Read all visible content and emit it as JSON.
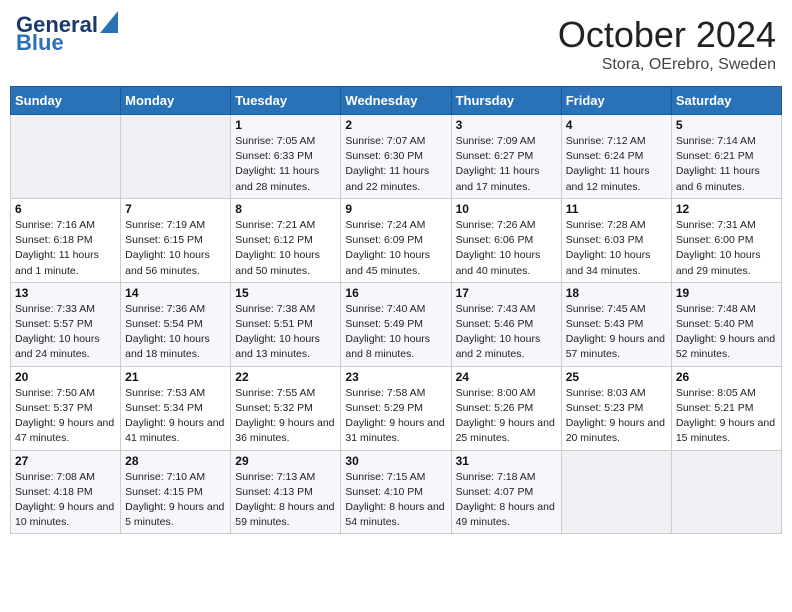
{
  "header": {
    "logo_line1": "General",
    "logo_line2": "Blue",
    "month": "October 2024",
    "location": "Stora, OErebro, Sweden"
  },
  "weekdays": [
    "Sunday",
    "Monday",
    "Tuesday",
    "Wednesday",
    "Thursday",
    "Friday",
    "Saturday"
  ],
  "weeks": [
    [
      {
        "day": "",
        "info": ""
      },
      {
        "day": "",
        "info": ""
      },
      {
        "day": "1",
        "info": "Sunrise: 7:05 AM\nSunset: 6:33 PM\nDaylight: 11 hours\nand 28 minutes."
      },
      {
        "day": "2",
        "info": "Sunrise: 7:07 AM\nSunset: 6:30 PM\nDaylight: 11 hours\nand 22 minutes."
      },
      {
        "day": "3",
        "info": "Sunrise: 7:09 AM\nSunset: 6:27 PM\nDaylight: 11 hours\nand 17 minutes."
      },
      {
        "day": "4",
        "info": "Sunrise: 7:12 AM\nSunset: 6:24 PM\nDaylight: 11 hours\nand 12 minutes."
      },
      {
        "day": "5",
        "info": "Sunrise: 7:14 AM\nSunset: 6:21 PM\nDaylight: 11 hours\nand 6 minutes."
      }
    ],
    [
      {
        "day": "6",
        "info": "Sunrise: 7:16 AM\nSunset: 6:18 PM\nDaylight: 11 hours\nand 1 minute."
      },
      {
        "day": "7",
        "info": "Sunrise: 7:19 AM\nSunset: 6:15 PM\nDaylight: 10 hours\nand 56 minutes."
      },
      {
        "day": "8",
        "info": "Sunrise: 7:21 AM\nSunset: 6:12 PM\nDaylight: 10 hours\nand 50 minutes."
      },
      {
        "day": "9",
        "info": "Sunrise: 7:24 AM\nSunset: 6:09 PM\nDaylight: 10 hours\nand 45 minutes."
      },
      {
        "day": "10",
        "info": "Sunrise: 7:26 AM\nSunset: 6:06 PM\nDaylight: 10 hours\nand 40 minutes."
      },
      {
        "day": "11",
        "info": "Sunrise: 7:28 AM\nSunset: 6:03 PM\nDaylight: 10 hours\nand 34 minutes."
      },
      {
        "day": "12",
        "info": "Sunrise: 7:31 AM\nSunset: 6:00 PM\nDaylight: 10 hours\nand 29 minutes."
      }
    ],
    [
      {
        "day": "13",
        "info": "Sunrise: 7:33 AM\nSunset: 5:57 PM\nDaylight: 10 hours\nand 24 minutes."
      },
      {
        "day": "14",
        "info": "Sunrise: 7:36 AM\nSunset: 5:54 PM\nDaylight: 10 hours\nand 18 minutes."
      },
      {
        "day": "15",
        "info": "Sunrise: 7:38 AM\nSunset: 5:51 PM\nDaylight: 10 hours\nand 13 minutes."
      },
      {
        "day": "16",
        "info": "Sunrise: 7:40 AM\nSunset: 5:49 PM\nDaylight: 10 hours\nand 8 minutes."
      },
      {
        "day": "17",
        "info": "Sunrise: 7:43 AM\nSunset: 5:46 PM\nDaylight: 10 hours\nand 2 minutes."
      },
      {
        "day": "18",
        "info": "Sunrise: 7:45 AM\nSunset: 5:43 PM\nDaylight: 9 hours\nand 57 minutes."
      },
      {
        "day": "19",
        "info": "Sunrise: 7:48 AM\nSunset: 5:40 PM\nDaylight: 9 hours\nand 52 minutes."
      }
    ],
    [
      {
        "day": "20",
        "info": "Sunrise: 7:50 AM\nSunset: 5:37 PM\nDaylight: 9 hours\nand 47 minutes."
      },
      {
        "day": "21",
        "info": "Sunrise: 7:53 AM\nSunset: 5:34 PM\nDaylight: 9 hours\nand 41 minutes."
      },
      {
        "day": "22",
        "info": "Sunrise: 7:55 AM\nSunset: 5:32 PM\nDaylight: 9 hours\nand 36 minutes."
      },
      {
        "day": "23",
        "info": "Sunrise: 7:58 AM\nSunset: 5:29 PM\nDaylight: 9 hours\nand 31 minutes."
      },
      {
        "day": "24",
        "info": "Sunrise: 8:00 AM\nSunset: 5:26 PM\nDaylight: 9 hours\nand 25 minutes."
      },
      {
        "day": "25",
        "info": "Sunrise: 8:03 AM\nSunset: 5:23 PM\nDaylight: 9 hours\nand 20 minutes."
      },
      {
        "day": "26",
        "info": "Sunrise: 8:05 AM\nSunset: 5:21 PM\nDaylight: 9 hours\nand 15 minutes."
      }
    ],
    [
      {
        "day": "27",
        "info": "Sunrise: 7:08 AM\nSunset: 4:18 PM\nDaylight: 9 hours\nand 10 minutes."
      },
      {
        "day": "28",
        "info": "Sunrise: 7:10 AM\nSunset: 4:15 PM\nDaylight: 9 hours\nand 5 minutes."
      },
      {
        "day": "29",
        "info": "Sunrise: 7:13 AM\nSunset: 4:13 PM\nDaylight: 8 hours\nand 59 minutes."
      },
      {
        "day": "30",
        "info": "Sunrise: 7:15 AM\nSunset: 4:10 PM\nDaylight: 8 hours\nand 54 minutes."
      },
      {
        "day": "31",
        "info": "Sunrise: 7:18 AM\nSunset: 4:07 PM\nDaylight: 8 hours\nand 49 minutes."
      },
      {
        "day": "",
        "info": ""
      },
      {
        "day": "",
        "info": ""
      }
    ]
  ]
}
